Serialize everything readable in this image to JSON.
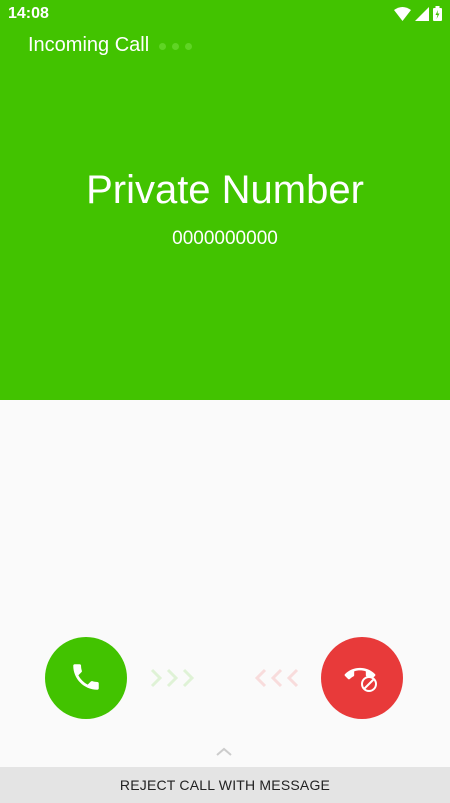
{
  "status_bar": {
    "time": "14:08",
    "icons": [
      "wifi-icon",
      "cell-signal-icon",
      "battery-icon"
    ]
  },
  "header": {
    "label": "Incoming Call"
  },
  "caller": {
    "name": "Private Number",
    "number": "0000000000"
  },
  "actions": {
    "answer_icon": "phone-icon",
    "decline_icon": "hangup-blocked-icon",
    "reject_with_message_label": "REJECT CALL WITH MESSAGE"
  },
  "colors": {
    "caller_background": "#42c300",
    "answer_button": "#42c300",
    "decline_button": "#e83a3a",
    "answer_chevron": "#dff2d6",
    "decline_chevron": "#f8dcdc",
    "lower_background": "#fafafa",
    "reject_bar": "#e4e4e4",
    "header_dots": "#5fd424"
  }
}
